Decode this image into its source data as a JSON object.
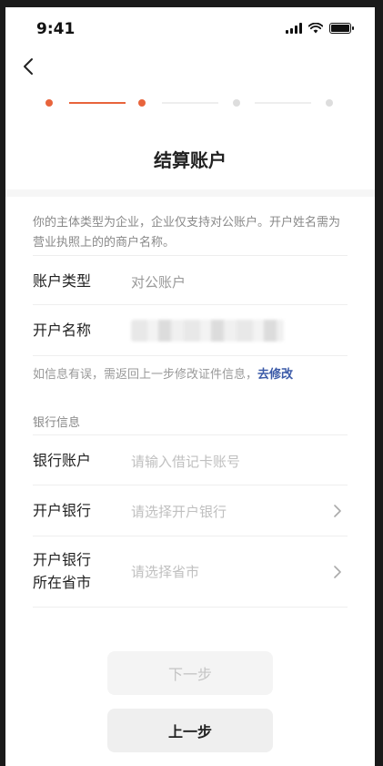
{
  "status_bar": {
    "time": "9:41",
    "icons": [
      "signal-icon",
      "wifi-icon",
      "battery-icon"
    ]
  },
  "header": {
    "back_icon": "chevron-left-icon",
    "title": "结算账户"
  },
  "steps": {
    "total": 4,
    "current": 2,
    "active_color": "#e8643c",
    "inactive_color": "#dddddd"
  },
  "notice": "你的主体类型为企业，企业仅支持对公账户。开户姓名需为营业执照上的的商户名称。",
  "account": {
    "type_label": "账户类型",
    "type_value": "对公账户",
    "name_label": "开户名称"
  },
  "hint": {
    "text": "如信息有误，需返回上一步修改证件信息，",
    "link": "去修改"
  },
  "bank": {
    "section_label": "银行信息",
    "account_label": "银行账户",
    "account_placeholder": "请输入借记卡账号",
    "bank_label": "开户银行",
    "bank_placeholder": "请选择开户银行",
    "city_label_line1": "开户银行",
    "city_label_line2": "所在省市",
    "city_placeholder": "请选择省市"
  },
  "buttons": {
    "next": "下一步",
    "prev": "上一步"
  },
  "colors": {
    "link": "#3b5aa8",
    "accent": "#e8643c"
  }
}
